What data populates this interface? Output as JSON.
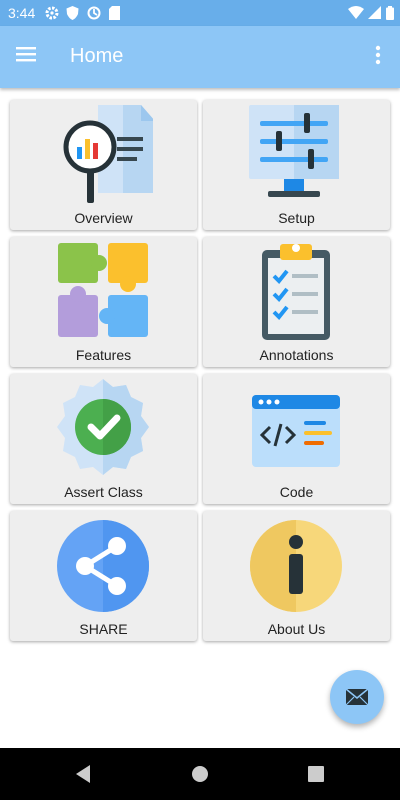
{
  "status_bar": {
    "time": "3:44",
    "left_icons": [
      "settings-icon",
      "shield-icon",
      "data-saver-icon",
      "sd-card-icon"
    ],
    "right_icons": [
      "wifi-icon",
      "signal-icon",
      "battery-icon"
    ]
  },
  "app_bar": {
    "title": "Home",
    "background": "#8dc6f6"
  },
  "tiles": [
    {
      "label": "Overview",
      "icon": "report-magnifier-icon"
    },
    {
      "label": "Setup",
      "icon": "settings-sliders-monitor-icon"
    },
    {
      "label": "Features",
      "icon": "puzzle-pieces-icon"
    },
    {
      "label": "Annotations",
      "icon": "clipboard-checklist-icon"
    },
    {
      "label": "Assert Class",
      "icon": "check-badge-icon"
    },
    {
      "label": "Code",
      "icon": "code-window-icon"
    },
    {
      "label": "SHARE",
      "icon": "share-icon"
    },
    {
      "label": "About Us",
      "icon": "info-icon"
    }
  ],
  "fab": {
    "icon": "mail-icon"
  },
  "nav_bar": {
    "buttons": [
      "back-icon",
      "home-icon",
      "recents-icon"
    ]
  }
}
